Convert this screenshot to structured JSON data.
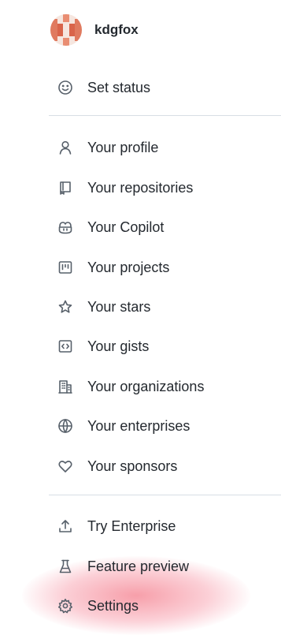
{
  "user": {
    "username": "kdgfox"
  },
  "menu": {
    "status": {
      "label": "Set status",
      "icon": "smiley-icon"
    },
    "profile_group": [
      {
        "id": "profile",
        "label": "Your profile",
        "icon": "person-icon"
      },
      {
        "id": "repositories",
        "label": "Your repositories",
        "icon": "repo-icon"
      },
      {
        "id": "copilot",
        "label": "Your Copilot",
        "icon": "copilot-icon"
      },
      {
        "id": "projects",
        "label": "Your projects",
        "icon": "project-icon"
      },
      {
        "id": "stars",
        "label": "Your stars",
        "icon": "star-icon"
      },
      {
        "id": "gists",
        "label": "Your gists",
        "icon": "code-square-icon"
      },
      {
        "id": "organizations",
        "label": "Your organizations",
        "icon": "organization-icon"
      },
      {
        "id": "enterprises",
        "label": "Your enterprises",
        "icon": "globe-icon"
      },
      {
        "id": "sponsors",
        "label": "Your sponsors",
        "icon": "heart-icon"
      }
    ],
    "bottom_group": [
      {
        "id": "try-enterprise",
        "label": "Try Enterprise",
        "icon": "upload-icon"
      },
      {
        "id": "feature-preview",
        "label": "Feature preview",
        "icon": "beaker-icon"
      },
      {
        "id": "settings",
        "label": "Settings",
        "icon": "gear-icon"
      }
    ]
  },
  "colors": {
    "text": "#24292f",
    "icon": "#57606a",
    "divider": "#d8dee4",
    "highlight": "#f05064"
  }
}
